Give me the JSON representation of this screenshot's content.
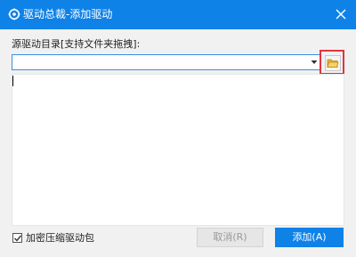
{
  "window": {
    "title": "驱动总裁-添加驱动",
    "icon": "gear-wrench-icon",
    "close_icon": "close-icon",
    "accent": "#0f82e8"
  },
  "form": {
    "source_label": "源驱动目录[支持文件夹拖拽]:",
    "source_value": "",
    "browse_icon": "folder-open-icon",
    "highlight_color": "#e0353b"
  },
  "footer": {
    "encrypt_label": "加密压缩驱动包",
    "encrypt_checked": true,
    "cancel_label": "取消(R)",
    "add_label": "添加(A)"
  }
}
